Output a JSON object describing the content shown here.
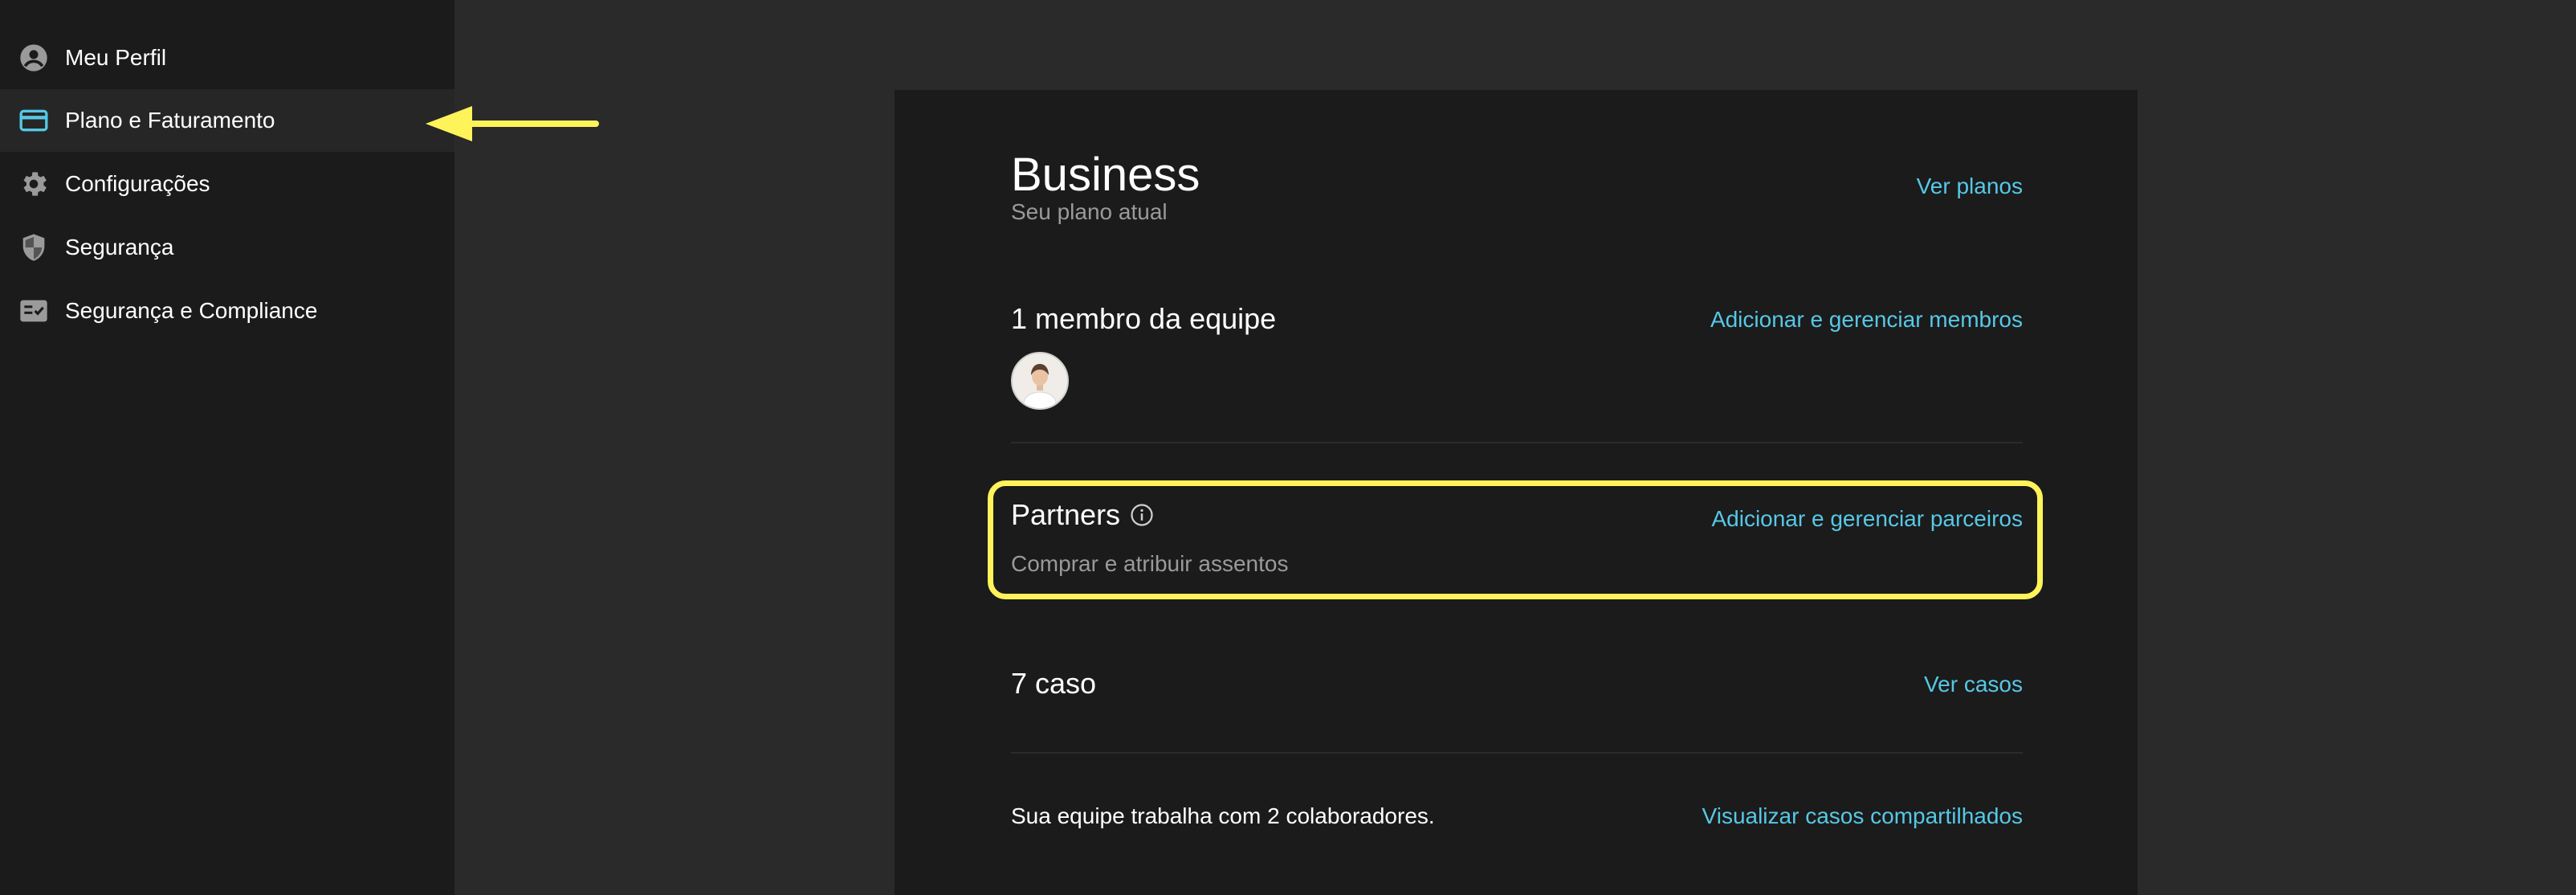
{
  "sidebar": {
    "items": [
      {
        "label": "Meu Perfil",
        "icon": "account-circle-icon",
        "active": false
      },
      {
        "label": "Plano e Faturamento",
        "icon": "credit-card-icon",
        "active": true
      },
      {
        "label": "Configurações",
        "icon": "gear-icon",
        "active": false
      },
      {
        "label": "Segurança",
        "icon": "shield-icon",
        "active": false
      },
      {
        "label": "Segurança e Compliance",
        "icon": "checklist-icon",
        "active": false
      }
    ]
  },
  "plan": {
    "name": "Business",
    "subtitle": "Seu plano atual",
    "link": "Ver planos"
  },
  "team": {
    "title": "1 membro da equipe",
    "link": "Adicionar e gerenciar membros"
  },
  "partners": {
    "title": "Partners",
    "subtitle": "Comprar e atribuir assentos",
    "link": "Adicionar e gerenciar parceiros"
  },
  "cases": {
    "title": "7 caso",
    "link": "Ver casos"
  },
  "collaborators": {
    "text": "Sua equipe trabalha com 2 colaboradores.",
    "link": "Visualizar casos compartilhados"
  },
  "colors": {
    "accent": "#56c8e6",
    "highlight": "#fff35a",
    "sidebar_bg": "#1b1b1b",
    "page_bg": "#2a2a2a"
  }
}
